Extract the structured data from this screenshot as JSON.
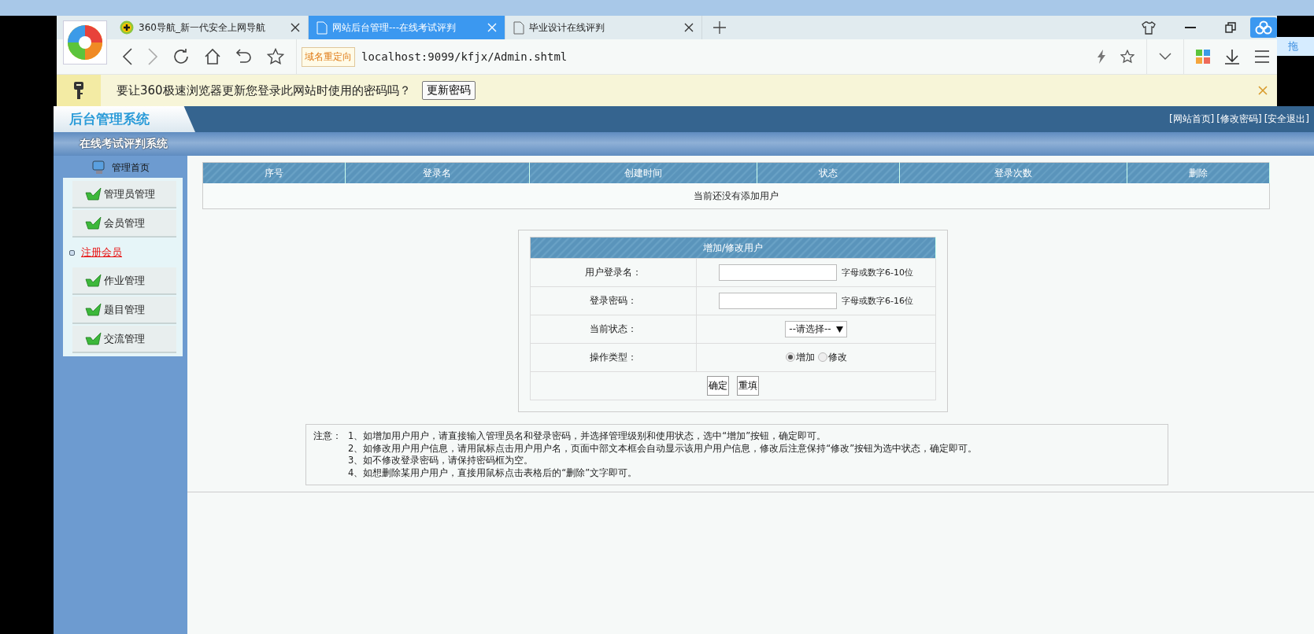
{
  "browser": {
    "tabs": [
      {
        "title": "360导航_新一代安全上网导航",
        "selected": false,
        "kind": "site"
      },
      {
        "title": "网站后台管理---在线考试评判",
        "selected": true,
        "kind": "page"
      },
      {
        "title": "毕业设计在线评判",
        "selected": false,
        "kind": "page"
      }
    ],
    "redirect_badge": "域名重定向",
    "url": "localhost:9099/kfjx/Admin.shtml",
    "side_button": "拖"
  },
  "password_bar": {
    "message": "要让360极速浏览器更新您登录此网站时使用的密码吗？",
    "button": "更新密码"
  },
  "header": {
    "logo": "后台管理系统",
    "links": [
      "[网站首页]",
      "[修改密码]",
      "[安全退出]"
    ],
    "subtitle": "在线考试评判系统"
  },
  "sidebar": {
    "home": "管理首页",
    "items": [
      {
        "label": "管理员管理",
        "kind": "group"
      },
      {
        "label": "会员管理",
        "kind": "group"
      },
      {
        "label": "注册会员",
        "kind": "link"
      },
      {
        "label": "作业管理",
        "kind": "group"
      },
      {
        "label": "题目管理",
        "kind": "group"
      },
      {
        "label": "交流管理",
        "kind": "group"
      }
    ]
  },
  "users_table": {
    "columns": [
      "序号",
      "登录名",
      "创建时间",
      "状态",
      "登录次数",
      "删除"
    ],
    "empty_message": "当前还没有添加用户"
  },
  "form": {
    "title": "增加/修改用户",
    "fields": [
      {
        "label": "用户登录名：",
        "kind": "text",
        "hint": "字母或数字6-10位"
      },
      {
        "label": "登录密码：",
        "kind": "password",
        "hint": "字母或数字6-16位"
      },
      {
        "label": "当前状态：",
        "kind": "select",
        "value": "--请选择--"
      },
      {
        "label": "操作类型：",
        "kind": "radio",
        "options": [
          {
            "label": "增加",
            "selected": true
          },
          {
            "label": "修改",
            "selected": false
          }
        ]
      }
    ],
    "buttons": [
      "确定",
      "重填"
    ]
  },
  "notes": {
    "prefix": "注意：",
    "lines": [
      "1、如增加用户用户，请直接输入管理员名和登录密码，并选择管理级别和使用状态，选中“增加”按钮，确定即可。",
      "2、如修改用户用户信息，请用鼠标点击用户用户名，页面中部文本框会自动显示该用户用户信息，修改后注意保持“修改”按钮为选中状态，确定即可。",
      "3、如不修改登录密码，请保持密码框为空。",
      "4、如想删除某用户用户，直接用鼠标点击表格后的“删除”文字即可。"
    ]
  }
}
